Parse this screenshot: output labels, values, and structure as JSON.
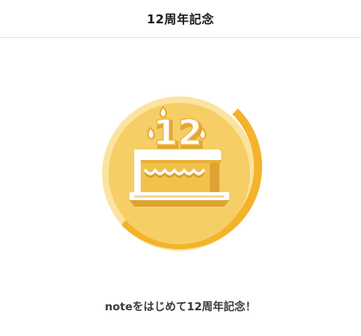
{
  "header": {
    "title": "12周年記念"
  },
  "badge": {
    "number": "12",
    "icon": "birthday-cake-icon",
    "colors": {
      "fill": "#F6CE66",
      "ring_light": "#FBE3A0",
      "ring_dark": "#F3B32A",
      "cake_top": "#FFFFFF",
      "cake_body": "#F2C14A",
      "cake_shadow": "#DFA232"
    }
  },
  "message": {
    "text": "noteをはじめて12周年記念！"
  }
}
